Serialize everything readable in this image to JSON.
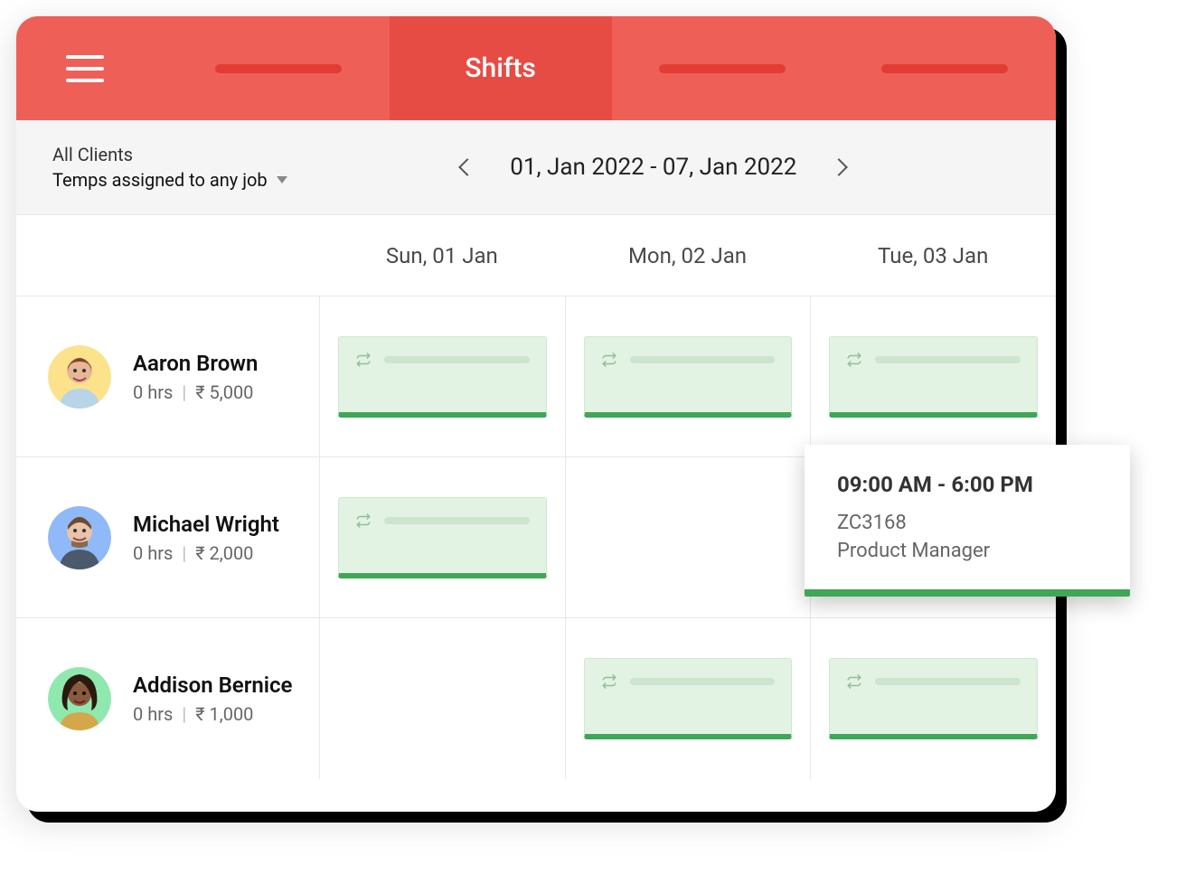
{
  "header": {
    "active_tab_label": "Shifts"
  },
  "filter": {
    "clients_label": "All Clients",
    "assigned_label": "Temps assigned to any job",
    "date_range": "01, Jan 2022 - 07, Jan 2022"
  },
  "day_headers": [
    "Sun, 01 Jan",
    "Mon, 02 Jan",
    "Tue, 03 Jan"
  ],
  "people": [
    {
      "name": "Aaron Brown",
      "hours": "0 hrs",
      "pay": "₹ 5,000",
      "avatar_bg": "#FCE28A",
      "shifts": [
        true,
        true,
        true
      ]
    },
    {
      "name": "Michael Wright",
      "hours": "0 hrs",
      "pay": "₹ 2,000",
      "avatar_bg": "#8FB9F8",
      "shifts": [
        true,
        false,
        false
      ]
    },
    {
      "name": "Addison Bernice",
      "hours": "0 hrs",
      "pay": "₹ 1,000",
      "avatar_bg": "#8FE8AE",
      "shifts": [
        false,
        true,
        true
      ]
    }
  ],
  "popup": {
    "time": "09:00 AM - 6:00 PM",
    "code": "ZC3168",
    "role": "Product Manager"
  }
}
